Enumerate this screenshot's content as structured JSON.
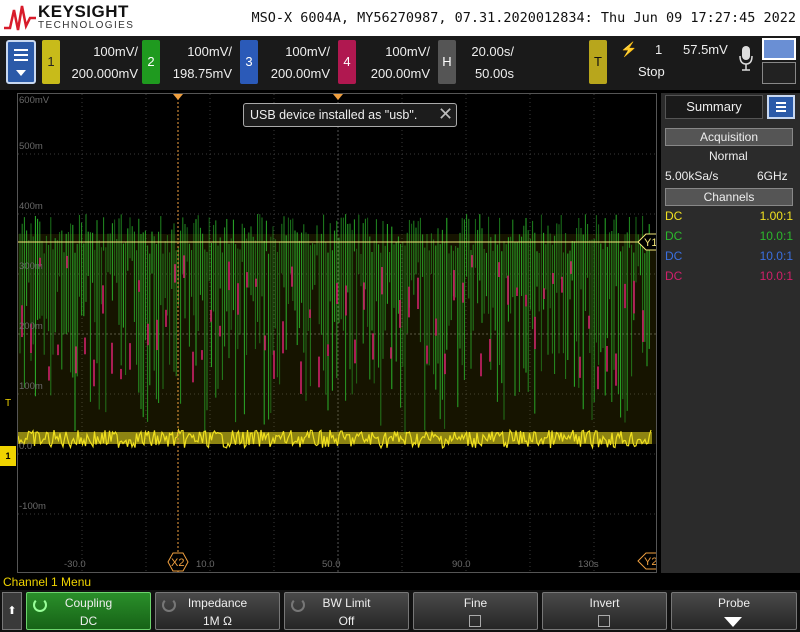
{
  "header": {
    "brand": "KEYSIGHT",
    "brand_sub": "TECHNOLOGIES",
    "instrument_line": "MSO-X 6004A, MY56270987, 07.31.2020012834: Thu Jun 09 17:27:45 2022"
  },
  "channels": [
    {
      "num": "1",
      "scale": "100mV/",
      "offset": "200.000mV",
      "color": "#f0e020"
    },
    {
      "num": "2",
      "scale": "100mV/",
      "offset": "198.75mV",
      "color": "#2cb82c"
    },
    {
      "num": "3",
      "scale": "100mV/",
      "offset": "200.00mV",
      "color": "#3a6fe0"
    },
    {
      "num": "4",
      "scale": "100mV/",
      "offset": "200.00mV",
      "color": "#d0206a"
    }
  ],
  "horizontal": {
    "key": "H",
    "timebase": "20.00s/",
    "delay": "50.00s"
  },
  "trigger": {
    "key": "T",
    "source": "1",
    "level": "57.5mV",
    "status": "Stop",
    "icon": "rising-edge-icon"
  },
  "graticule": {
    "y_labels": [
      "600mV",
      "500m",
      "400m",
      "300m",
      "200m",
      "100m",
      "0.0",
      "-100m"
    ],
    "x_labels": [
      "-30.0",
      "10.0",
      "50.0",
      "90.0",
      "130s"
    ],
    "cursor_labels": {
      "y1": "Y1",
      "y2": "Y2",
      "x2": "X2"
    }
  },
  "toast": {
    "message": "USB device installed as \"usb\"."
  },
  "sidebar": {
    "tab": "Summary",
    "acquisition_head": "Acquisition",
    "acq_mode": "Normal",
    "sample_rate": "5.00kSa/s",
    "bandwidth": "6GHz",
    "channels_head": "Channels",
    "channel_rows": [
      {
        "coupling": "DC",
        "probe": "1.00:1",
        "color": "#f0e020"
      },
      {
        "coupling": "DC",
        "probe": "10.0:1",
        "color": "#2cb82c"
      },
      {
        "coupling": "DC",
        "probe": "10.0:1",
        "color": "#3a6fe0"
      },
      {
        "coupling": "DC",
        "probe": "10.0:1",
        "color": "#d0206a"
      }
    ]
  },
  "menu": {
    "title": "Channel 1 Menu",
    "softkeys": [
      {
        "label": "Coupling",
        "value": "DC"
      },
      {
        "label": "Impedance",
        "value": "1M Ω"
      },
      {
        "label": "BW Limit",
        "value": "Off"
      },
      {
        "label": "Fine",
        "value": ""
      },
      {
        "label": "Invert",
        "value": ""
      },
      {
        "label": "Probe",
        "value": ""
      }
    ]
  }
}
